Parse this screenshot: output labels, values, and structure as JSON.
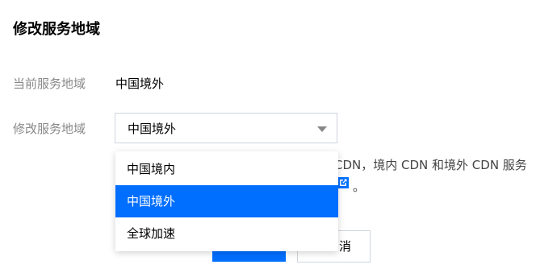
{
  "dialog": {
    "title": "修改服务地域"
  },
  "form": {
    "current_region_label": "当前服务地域",
    "current_region_value": "中国境外",
    "modify_region_label": "修改服务地域",
    "select_value": "中国境外"
  },
  "dropdown": {
    "options": [
      {
        "label": "中国境内",
        "selected": false
      },
      {
        "label": "中国境外",
        "selected": true
      },
      {
        "label": "全球加速",
        "selected": false
      }
    ]
  },
  "description": {
    "line1_visible": "CDN，境内 CDN 和境外 CDN 服务",
    "line2_suffix": "。",
    "link_icon": "external-link-icon"
  },
  "buttons": {
    "cancel_label_visible": "消"
  },
  "colors": {
    "accent": "#006eff",
    "border": "#cfd5de",
    "label_gray": "#888888"
  }
}
